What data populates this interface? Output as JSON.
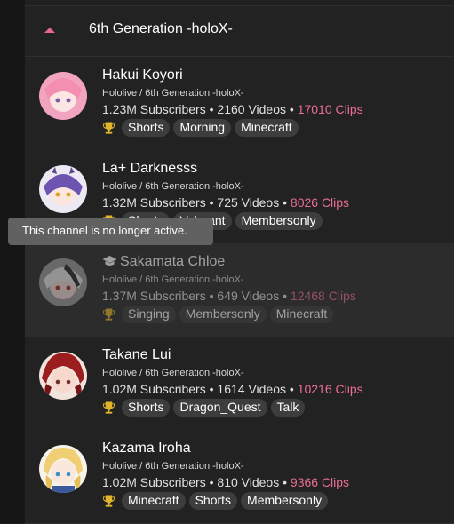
{
  "group": {
    "title": "6th Generation -holoX-"
  },
  "tooltip": "This channel is no longer active.",
  "channels": [
    {
      "name": "Hakui Koyori",
      "org": "Hololive / 6th Generation -holoX-",
      "subscribers": "1.23M Subscribers",
      "videos": "2160 Videos",
      "clips": "17010 Clips",
      "tags": [
        "Shorts",
        "Morning",
        "Minecraft"
      ],
      "active": true,
      "avatar_color": "#f2a3c0"
    },
    {
      "name": "La+ Darknesss",
      "org": "Hololive / 6th Generation -holoX-",
      "subscribers": "1.32M Subscribers",
      "videos": "725 Videos",
      "clips": "8026 Clips",
      "tags": [
        "Shorts",
        "Valorant",
        "Membersonly"
      ],
      "active": true,
      "avatar_color": "#8b74c9"
    },
    {
      "name": "Sakamata Chloe",
      "org": "Hololive / 6th Generation -holoX-",
      "subscribers": "1.37M Subscribers",
      "videos": "649 Videos",
      "clips": "12468 Clips",
      "tags": [
        "Singing",
        "Membersonly",
        "Minecraft"
      ],
      "active": false,
      "avatar_color": "#c9c9c9"
    },
    {
      "name": "Takane Lui",
      "org": "Hololive / 6th Generation -holoX-",
      "subscribers": "1.02M Subscribers",
      "videos": "1614 Videos",
      "clips": "10216 Clips",
      "tags": [
        "Shorts",
        "Dragon_Quest",
        "Talk"
      ],
      "active": true,
      "avatar_color": "#b3261e"
    },
    {
      "name": "Kazama Iroha",
      "org": "Hololive / 6th Generation -holoX-",
      "subscribers": "1.02M Subscribers",
      "videos": "810 Videos",
      "clips": "9366 Clips",
      "tags": [
        "Minecraft",
        "Shorts",
        "Membersonly"
      ],
      "active": true,
      "avatar_color": "#f3d27a"
    }
  ],
  "colors": {
    "accent": "#ea6e92",
    "tag_bg": "#3d3d3d",
    "trophy": "#e0b42b",
    "tooltip_bg": "#616161"
  }
}
